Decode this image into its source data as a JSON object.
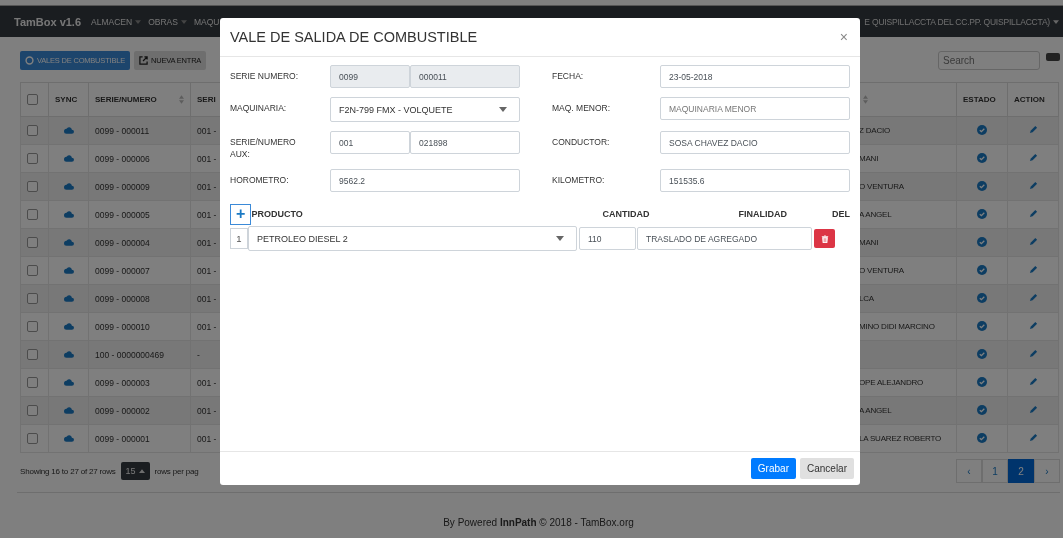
{
  "navbar": {
    "brand": "TamBox v1.6",
    "menus": [
      "ALMACEN",
      "OBRAS",
      "MAQU"
    ],
    "user_text": "E QUISPILLACCTA DEL CC.PP. QUISPILLACCTA)"
  },
  "toolbar": {
    "buttons": [
      {
        "label": "VALES DE COMBUSTIBLE",
        "selected": true
      },
      {
        "label": "NUEVA ENTRA",
        "selected": false
      }
    ],
    "search": {
      "placeholder": "Search"
    }
  },
  "table": {
    "header_checked": false,
    "columns": [
      {},
      {
        "label": "SYNC"
      },
      {
        "label": "SERIE/NUMERO",
        "sortable": true
      },
      {
        "label": "SERI"
      },
      {
        "sortable": true
      },
      {
        "label": "ESTADO"
      },
      {
        "label": "ACTION"
      }
    ],
    "rows": [
      {
        "checked": false,
        "serie_numero": "0099 - 000011",
        "column_4": "001 -",
        "column_5": "Z DACIO"
      },
      {
        "checked": false,
        "serie_numero": "0099 - 000006",
        "column_4": "001 -",
        "column_5": "MANI"
      },
      {
        "checked": false,
        "serie_numero": "0099 - 000009",
        "column_4": "001 -",
        "column_5": "O VENTURA"
      },
      {
        "checked": false,
        "serie_numero": "0099 - 000005",
        "column_4": "001 -",
        "column_5": "A ANGEL"
      },
      {
        "checked": false,
        "serie_numero": "0099 - 000004",
        "column_4": "001 -",
        "column_5": "MANI"
      },
      {
        "checked": false,
        "serie_numero": "0099 - 000007",
        "column_4": "001 -",
        "column_5": "O VENTURA"
      },
      {
        "checked": false,
        "serie_numero": "0099 - 000008",
        "column_4": "001 -",
        "column_5": "LCA"
      },
      {
        "checked": false,
        "serie_numero": "0099 - 000010",
        "column_4": "001 -",
        "column_5": "MINO DIDI MARCINO"
      },
      {
        "checked": false,
        "serie_numero": "100 - 0000000469",
        "column_4": "-"
      },
      {
        "checked": false,
        "serie_numero": "0099 - 000003",
        "column_4": "001 -",
        "column_5": "OPE ALEJANDRO"
      },
      {
        "checked": false,
        "serie_numero": "0099 - 000002",
        "column_4": "001 -",
        "column_5": "A ANGEL"
      },
      {
        "checked": false,
        "serie_numero": "0099 - 000001",
        "column_4": "001 -",
        "column_5": "LA SUAREZ ROBERTO"
      }
    ]
  },
  "pagination": {
    "summary": "Showing 16 to 27 of 27 rows",
    "page_size": "15",
    "page_size_suffix": "rows per pag",
    "pages": [
      {
        "label": "‹",
        "selected": false
      },
      {
        "label": "1",
        "selected": false
      },
      {
        "label": "2",
        "selected": true
      },
      {
        "label": "›",
        "selected": false
      }
    ]
  },
  "footer": "By Powered **InnPath** © 2018 - TamBox.org",
  "modal": {
    "title": "VALE DE SALIDA DE COMBUSTIBLE",
    "close": "×",
    "fields": [
      {
        "kind": "pair",
        "label": "SERIE NUMERO:",
        "values": [
          "0099",
          "000011"
        ],
        "disabled": true
      },
      {
        "kind": "text",
        "label": "FECHA:",
        "value": "23-05-2018"
      },
      {
        "kind": "select",
        "label": "MAQUINARIA:",
        "value": "F2N-799 FMX - VOLQUETE"
      },
      {
        "kind": "text",
        "label": "MAQ. MENOR:",
        "placeholder": "MAQUINARIA MENOR"
      },
      {
        "kind": "pair",
        "label": "SERIE/NUMERO AUX:",
        "values": [
          "001",
          "021898"
        ],
        "disabled": false
      },
      {
        "kind": "text",
        "label": "CONDUCTOR:",
        "value": "SOSA CHAVEZ DACIO"
      },
      {
        "kind": "text",
        "label": "HOROMETRO:",
        "value": "9562.2"
      },
      {
        "kind": "text",
        "label": "KILOMETRO:",
        "value": "151535.6"
      }
    ],
    "products": {
      "add": "+",
      "columns": [
        "PRODUCTO",
        "CANTIDAD",
        "FINALIDAD",
        "DEL"
      ],
      "rows": [
        {
          "index": "1",
          "producto": "PETROLEO DIESEL 2",
          "cantidad": "110",
          "finalidad": "TRASLADO DE AGREGADO"
        }
      ]
    },
    "buttons": [
      {
        "label": "Grabar",
        "kind": "primary"
      },
      {
        "label": "Cancelar",
        "kind": "secondary"
      }
    ]
  }
}
